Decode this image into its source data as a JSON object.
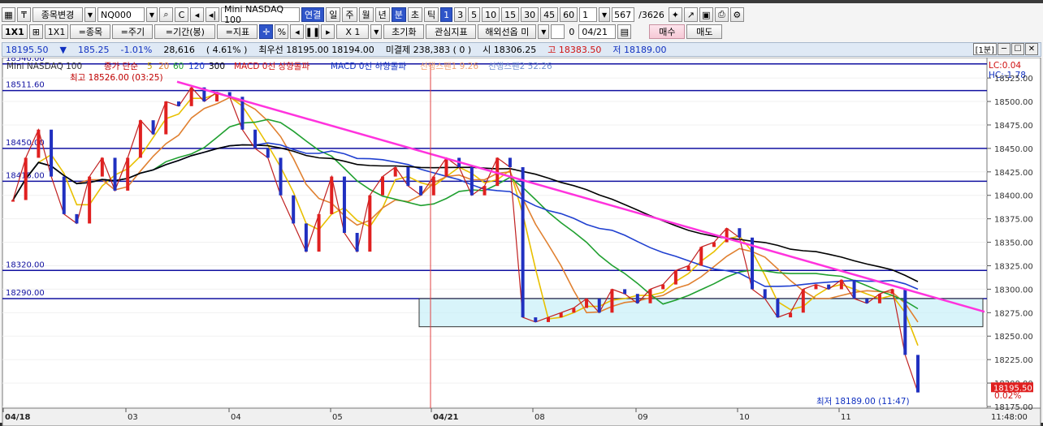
{
  "toolbar1": {
    "code_change": "종목변경",
    "code": "NQ000",
    "product": "Mini NASDAQ 100",
    "link": "연결",
    "periods": [
      "일",
      "주",
      "월",
      "년",
      "분",
      "초",
      "틱"
    ],
    "nums": [
      "1",
      "3",
      "5",
      "10",
      "15",
      "30",
      "45",
      "60"
    ],
    "count": "1",
    "ratio": "567",
    "ratio_total": "/3626"
  },
  "toolbar2": {
    "layout": "1X1",
    "layout2": "1X1",
    "item_btn": "=종목",
    "period_btn": "=주기",
    "range_btn": "=기간(봉)",
    "ind_btn": "=지표",
    "pct": "%",
    "mult": "X 1",
    "reset": "초기화",
    "interest": "관심지표",
    "overseas": "해외선옵 미",
    "date_prefix": "0",
    "date": "04/21",
    "buy": "매수",
    "sell": "매도"
  },
  "info": {
    "price": "18195.50",
    "arrow": "▼",
    "change": "185.25",
    "pct": "-1.01%",
    "volume": "28,616",
    "vol_pct": "( 4.61% )",
    "best": "최우선 18195.00 18194.00",
    "oi": "미결제  238,383 (      0 )",
    "open": "시 18306.25",
    "high": "고 18383.50",
    "low": "저 18189.00",
    "tag": "[1분]"
  },
  "legend": {
    "product": "Mini NASDAQ 100",
    "ma_label": "종가 단순",
    "ma": [
      "5",
      "20",
      "60",
      "120",
      "300"
    ],
    "ma_colors": [
      "#e8c000",
      "#e08030",
      "#20a030",
      "#2040d0",
      "#000000"
    ],
    "macd_up": "MACD 0선 상향돌파",
    "macd_down": "MACD 0선 하향돌파",
    "span1": "선행스팬1 9.26",
    "span2": "선행스팬2 52.26",
    "lc": "LC:0.04",
    "hc": "HC:-1.78"
  },
  "annotations": {
    "high": "최고 18526.00 (03:25)",
    "low": "최저 18189.00 (11:47)",
    "last_pct": "0.02%"
  },
  "chart_data": {
    "type": "line",
    "ylim": [
      18175,
      18545
    ],
    "y_ticks": [
      "18525.00",
      "18500.00",
      "18475.00",
      "18450.00",
      "18425.00",
      "18400.00",
      "18375.00",
      "18350.00",
      "18325.00",
      "18300.00",
      "18275.00",
      "18250.00",
      "18225.00",
      "18200.00",
      "18175.00"
    ],
    "x_labels": [
      "04/18",
      "03",
      "04",
      "05",
      "04/21",
      "08",
      "09",
      "10",
      "11",
      "11:48:00"
    ],
    "levels": [
      {
        "label": "18540.00",
        "value": 18540
      },
      {
        "label": "18511.60",
        "value": 18511.6
      },
      {
        "label": "18450.00",
        "value": 18450
      },
      {
        "label": "18415.00",
        "value": 18415
      },
      {
        "label": "18320.00",
        "value": 18320
      },
      {
        "label": "18290.00",
        "value": 18290
      }
    ],
    "box": {
      "y_top": 18290,
      "y_bottom": 18260
    },
    "trendline": {
      "start": 18521,
      "end": 18276
    },
    "last": "18195.50",
    "price": [
      18395,
      18440,
      18470,
      18420,
      18380,
      18370,
      18420,
      18440,
      18405,
      18440,
      18480,
      18465,
      18500,
      18495,
      18515,
      18500,
      18510,
      18505,
      18470,
      18450,
      18440,
      18400,
      18370,
      18340,
      18380,
      18420,
      18360,
      18340,
      18400,
      18420,
      18430,
      18410,
      18400,
      18420,
      18440,
      18430,
      18400,
      18410,
      18440,
      18430,
      18270,
      18265,
      18270,
      18275,
      18280,
      18290,
      18275,
      18300,
      18295,
      18285,
      18300,
      18305,
      18320,
      18325,
      18345,
      18350,
      18365,
      18355,
      18300,
      18290,
      18270,
      18275,
      18300,
      18305,
      18300,
      18310,
      18290,
      18285,
      18295,
      18300,
      18230,
      18190
    ]
  }
}
